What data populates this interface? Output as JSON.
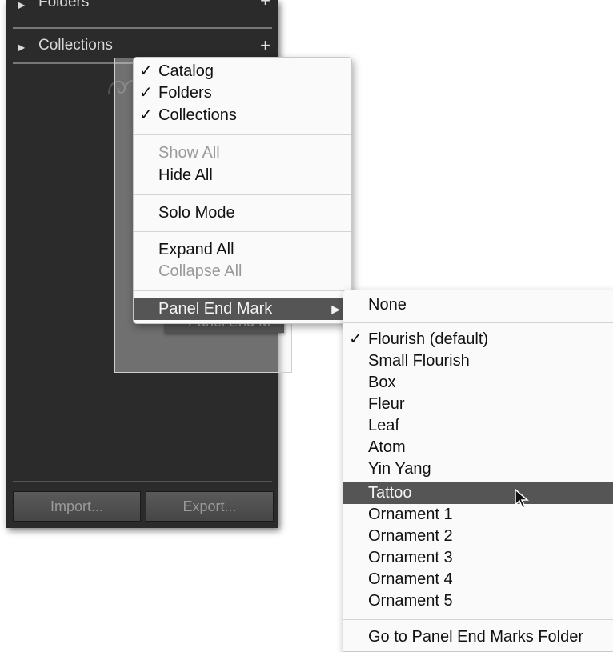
{
  "panel": {
    "headers": {
      "folders": "Folders",
      "collections": "Collections"
    },
    "buttons": {
      "import": "Import...",
      "export": "Export..."
    }
  },
  "ghost_item_label": "Panel End M",
  "context_menu": {
    "items": [
      {
        "label": "Catalog",
        "checked": true
      },
      {
        "label": "Folders",
        "checked": true
      },
      {
        "label": "Collections",
        "checked": true
      },
      {
        "label": "Show All",
        "disabled": true
      },
      {
        "label": "Hide All"
      },
      {
        "label": "Solo Mode"
      },
      {
        "label": "Expand All"
      },
      {
        "label": "Collapse All",
        "disabled": true
      },
      {
        "label": "Panel End Mark",
        "highlighted": true,
        "has_submenu": true
      }
    ]
  },
  "submenu": {
    "items": [
      {
        "label": "None"
      },
      {
        "label": "Flourish (default)",
        "checked": true
      },
      {
        "label": "Small Flourish"
      },
      {
        "label": "Box"
      },
      {
        "label": "Fleur"
      },
      {
        "label": "Leaf"
      },
      {
        "label": "Atom"
      },
      {
        "label": "Yin Yang"
      },
      {
        "label": "Tattoo",
        "highlighted": true
      },
      {
        "label": "Ornament 1"
      },
      {
        "label": "Ornament 2"
      },
      {
        "label": "Ornament 3"
      },
      {
        "label": "Ornament 4"
      },
      {
        "label": "Ornament 5"
      },
      {
        "label": "Go to Panel End Marks Folder"
      }
    ]
  },
  "glyphs": {
    "check": "✓",
    "triangle": "▶",
    "plus": "+"
  },
  "colors": {
    "panel_bg": "#2b2b2b",
    "menu_bg": "#fafafa",
    "highlight": "#555555",
    "disabled_text": "#9a9a9a"
  }
}
